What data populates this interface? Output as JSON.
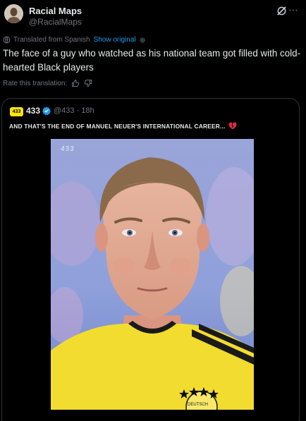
{
  "author": {
    "name": "Racial Maps",
    "handle": "@RacialMaps"
  },
  "translation": {
    "label": "Translated from Spanish",
    "show_original": "Show original",
    "rate_label": "Rate this translation:"
  },
  "tweet": {
    "text": "The face of a guy who watched as his national team got filled with cold-hearted Black players"
  },
  "quote": {
    "logo_text": "433",
    "name": "433",
    "handle_time": "@433 · 18h",
    "text": "AND THAT'S THE END OF MANUEL NEUER'S INTERNATIONAL CAREER...",
    "watermark": "433",
    "crest_text": "DEUTSCH"
  },
  "colors": {
    "background": "#000000",
    "accent": "#1d9bf0",
    "muted": "#71767b",
    "logo_yellow": "#ffe500",
    "jersey_yellow": "#f2dc2f"
  },
  "icons": {
    "grok": "grok-icon",
    "more": "more-icon",
    "translate": "globe-icon",
    "settings": "gear-icon",
    "thumbs_up": "thumbs-up-icon",
    "thumbs_down": "thumbs-down-icon",
    "verified": "verified-badge-icon",
    "broken_heart": "broken-heart-icon"
  }
}
